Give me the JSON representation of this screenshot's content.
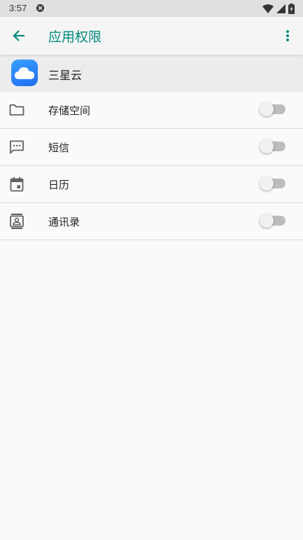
{
  "status_bar": {
    "time": "3:57",
    "notification_icon": "block-icon",
    "icons": [
      "wifi-icon",
      "signal-icon",
      "battery-charging-icon"
    ]
  },
  "app_bar": {
    "title": "应用权限",
    "back_icon": "arrow-back-icon",
    "menu_icon": "more-vert-icon",
    "accent_color": "#00897b"
  },
  "app_header": {
    "name": "三星云",
    "icon": "cloud-icon"
  },
  "permissions": [
    {
      "label": "存储空间",
      "icon": "folder-icon",
      "enabled": false
    },
    {
      "label": "短信",
      "icon": "sms-icon",
      "enabled": false
    },
    {
      "label": "日历",
      "icon": "calendar-icon",
      "enabled": false
    },
    {
      "label": "通讯录",
      "icon": "contacts-icon",
      "enabled": false
    }
  ]
}
